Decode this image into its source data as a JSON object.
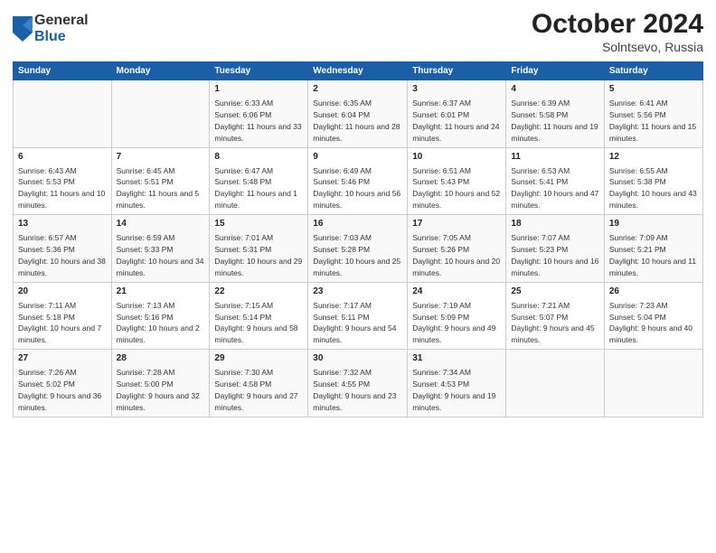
{
  "logo": {
    "general": "General",
    "blue": "Blue"
  },
  "title": "October 2024",
  "location": "Solntsevo, Russia",
  "headers": [
    "Sunday",
    "Monday",
    "Tuesday",
    "Wednesday",
    "Thursday",
    "Friday",
    "Saturday"
  ],
  "weeks": [
    [
      {
        "day": "",
        "sunrise": "",
        "sunset": "",
        "daylight": ""
      },
      {
        "day": "",
        "sunrise": "",
        "sunset": "",
        "daylight": ""
      },
      {
        "day": "1",
        "sunrise": "Sunrise: 6:33 AM",
        "sunset": "Sunset: 6:06 PM",
        "daylight": "Daylight: 11 hours and 33 minutes."
      },
      {
        "day": "2",
        "sunrise": "Sunrise: 6:35 AM",
        "sunset": "Sunset: 6:04 PM",
        "daylight": "Daylight: 11 hours and 28 minutes."
      },
      {
        "day": "3",
        "sunrise": "Sunrise: 6:37 AM",
        "sunset": "Sunset: 6:01 PM",
        "daylight": "Daylight: 11 hours and 24 minutes."
      },
      {
        "day": "4",
        "sunrise": "Sunrise: 6:39 AM",
        "sunset": "Sunset: 5:58 PM",
        "daylight": "Daylight: 11 hours and 19 minutes."
      },
      {
        "day": "5",
        "sunrise": "Sunrise: 6:41 AM",
        "sunset": "Sunset: 5:56 PM",
        "daylight": "Daylight: 11 hours and 15 minutes."
      }
    ],
    [
      {
        "day": "6",
        "sunrise": "Sunrise: 6:43 AM",
        "sunset": "Sunset: 5:53 PM",
        "daylight": "Daylight: 11 hours and 10 minutes."
      },
      {
        "day": "7",
        "sunrise": "Sunrise: 6:45 AM",
        "sunset": "Sunset: 5:51 PM",
        "daylight": "Daylight: 11 hours and 5 minutes."
      },
      {
        "day": "8",
        "sunrise": "Sunrise: 6:47 AM",
        "sunset": "Sunset: 5:48 PM",
        "daylight": "Daylight: 11 hours and 1 minute."
      },
      {
        "day": "9",
        "sunrise": "Sunrise: 6:49 AM",
        "sunset": "Sunset: 5:46 PM",
        "daylight": "Daylight: 10 hours and 56 minutes."
      },
      {
        "day": "10",
        "sunrise": "Sunrise: 6:51 AM",
        "sunset": "Sunset: 5:43 PM",
        "daylight": "Daylight: 10 hours and 52 minutes."
      },
      {
        "day": "11",
        "sunrise": "Sunrise: 6:53 AM",
        "sunset": "Sunset: 5:41 PM",
        "daylight": "Daylight: 10 hours and 47 minutes."
      },
      {
        "day": "12",
        "sunrise": "Sunrise: 6:55 AM",
        "sunset": "Sunset: 5:38 PM",
        "daylight": "Daylight: 10 hours and 43 minutes."
      }
    ],
    [
      {
        "day": "13",
        "sunrise": "Sunrise: 6:57 AM",
        "sunset": "Sunset: 5:36 PM",
        "daylight": "Daylight: 10 hours and 38 minutes."
      },
      {
        "day": "14",
        "sunrise": "Sunrise: 6:59 AM",
        "sunset": "Sunset: 5:33 PM",
        "daylight": "Daylight: 10 hours and 34 minutes."
      },
      {
        "day": "15",
        "sunrise": "Sunrise: 7:01 AM",
        "sunset": "Sunset: 5:31 PM",
        "daylight": "Daylight: 10 hours and 29 minutes."
      },
      {
        "day": "16",
        "sunrise": "Sunrise: 7:03 AM",
        "sunset": "Sunset: 5:28 PM",
        "daylight": "Daylight: 10 hours and 25 minutes."
      },
      {
        "day": "17",
        "sunrise": "Sunrise: 7:05 AM",
        "sunset": "Sunset: 5:26 PM",
        "daylight": "Daylight: 10 hours and 20 minutes."
      },
      {
        "day": "18",
        "sunrise": "Sunrise: 7:07 AM",
        "sunset": "Sunset: 5:23 PM",
        "daylight": "Daylight: 10 hours and 16 minutes."
      },
      {
        "day": "19",
        "sunrise": "Sunrise: 7:09 AM",
        "sunset": "Sunset: 5:21 PM",
        "daylight": "Daylight: 10 hours and 11 minutes."
      }
    ],
    [
      {
        "day": "20",
        "sunrise": "Sunrise: 7:11 AM",
        "sunset": "Sunset: 5:18 PM",
        "daylight": "Daylight: 10 hours and 7 minutes."
      },
      {
        "day": "21",
        "sunrise": "Sunrise: 7:13 AM",
        "sunset": "Sunset: 5:16 PM",
        "daylight": "Daylight: 10 hours and 2 minutes."
      },
      {
        "day": "22",
        "sunrise": "Sunrise: 7:15 AM",
        "sunset": "Sunset: 5:14 PM",
        "daylight": "Daylight: 9 hours and 58 minutes."
      },
      {
        "day": "23",
        "sunrise": "Sunrise: 7:17 AM",
        "sunset": "Sunset: 5:11 PM",
        "daylight": "Daylight: 9 hours and 54 minutes."
      },
      {
        "day": "24",
        "sunrise": "Sunrise: 7:19 AM",
        "sunset": "Sunset: 5:09 PM",
        "daylight": "Daylight: 9 hours and 49 minutes."
      },
      {
        "day": "25",
        "sunrise": "Sunrise: 7:21 AM",
        "sunset": "Sunset: 5:07 PM",
        "daylight": "Daylight: 9 hours and 45 minutes."
      },
      {
        "day": "26",
        "sunrise": "Sunrise: 7:23 AM",
        "sunset": "Sunset: 5:04 PM",
        "daylight": "Daylight: 9 hours and 40 minutes."
      }
    ],
    [
      {
        "day": "27",
        "sunrise": "Sunrise: 7:26 AM",
        "sunset": "Sunset: 5:02 PM",
        "daylight": "Daylight: 9 hours and 36 minutes."
      },
      {
        "day": "28",
        "sunrise": "Sunrise: 7:28 AM",
        "sunset": "Sunset: 5:00 PM",
        "daylight": "Daylight: 9 hours and 32 minutes."
      },
      {
        "day": "29",
        "sunrise": "Sunrise: 7:30 AM",
        "sunset": "Sunset: 4:58 PM",
        "daylight": "Daylight: 9 hours and 27 minutes."
      },
      {
        "day": "30",
        "sunrise": "Sunrise: 7:32 AM",
        "sunset": "Sunset: 4:55 PM",
        "daylight": "Daylight: 9 hours and 23 minutes."
      },
      {
        "day": "31",
        "sunrise": "Sunrise: 7:34 AM",
        "sunset": "Sunset: 4:53 PM",
        "daylight": "Daylight: 9 hours and 19 minutes."
      },
      {
        "day": "",
        "sunrise": "",
        "sunset": "",
        "daylight": ""
      },
      {
        "day": "",
        "sunrise": "",
        "sunset": "",
        "daylight": ""
      }
    ]
  ]
}
